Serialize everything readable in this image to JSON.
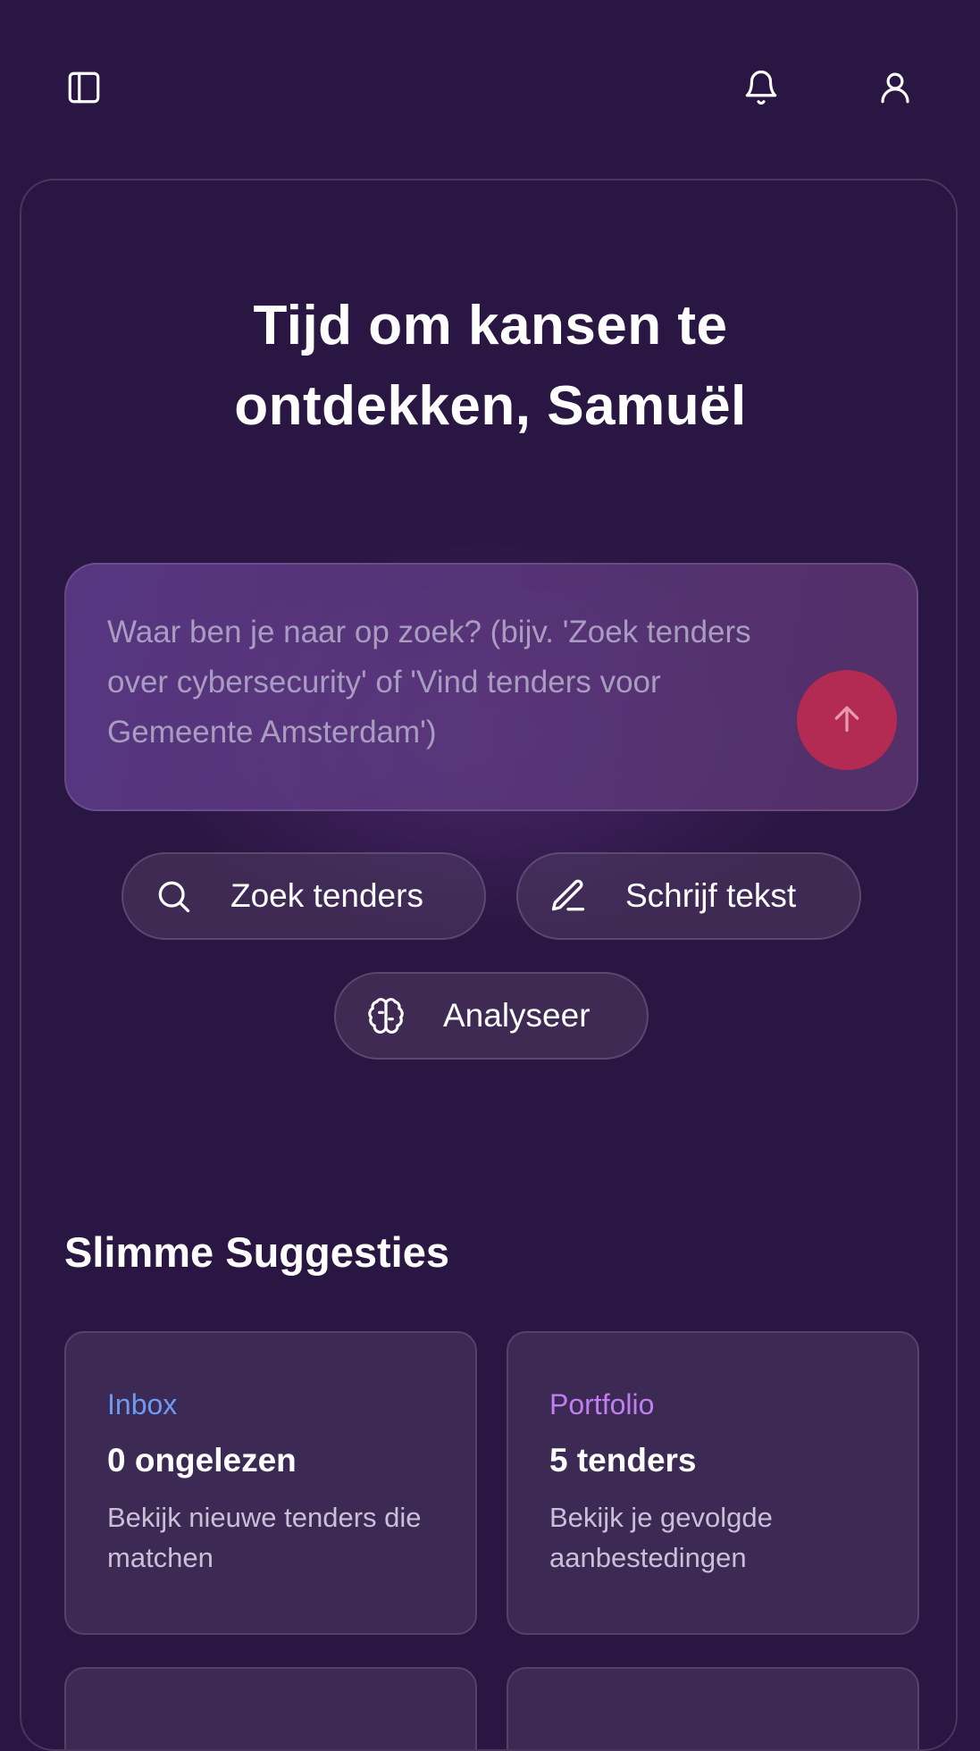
{
  "header": {
    "icons": [
      "sidebar-toggle-icon",
      "bell-icon",
      "user-icon"
    ]
  },
  "hero": {
    "line1": "Tijd om kansen te",
    "line2": "ontdekken, Samuël"
  },
  "search": {
    "placeholder": "Waar ben je naar op zoek? (bijv. 'Zoek tenders over cybersecurity' of 'Vind tenders voor Gemeente Amsterdam')",
    "send_icon": "arrow-up-icon"
  },
  "actions": [
    {
      "label": "Zoek tenders",
      "icon": "search-icon"
    },
    {
      "label": "Schrijf tekst",
      "icon": "pencil-icon"
    },
    {
      "label": "Analyseer",
      "icon": "brain-icon"
    }
  ],
  "suggestions": {
    "title": "Slimme Suggesties",
    "cards": [
      {
        "label": "Inbox",
        "label_color": "#6d9bf2",
        "title": "0 ongelezen",
        "description": "Bekijk nieuwe tenders die matchen"
      },
      {
        "label": "Portfolio",
        "label_color": "#c07ef0",
        "title": "5 tenders",
        "description": "Bekijk je gevolgde aanbestedingen"
      }
    ]
  },
  "colors": {
    "background": "#2a1642",
    "send_button": "#b32a52"
  }
}
